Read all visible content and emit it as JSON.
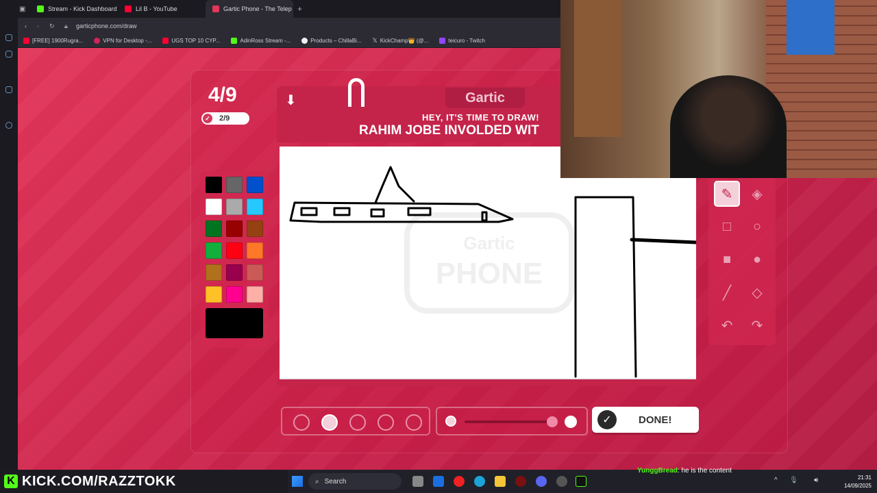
{
  "browser": {
    "tabs": [
      {
        "label": "Stream - Kick Dashboard",
        "color": "#53fc18"
      },
      {
        "label": "Lil B - YouTube",
        "color": "#ff0033"
      },
      {
        "label": "Gartic Phone - The Telep",
        "color": "#e2365a",
        "active": true
      }
    ],
    "url": "garticphone.com/draw",
    "bookmarks": [
      {
        "label": "[FREE] 1900Rugra...",
        "color": "#ff0033"
      },
      {
        "label": "VPN for Desktop -...",
        "color": "#d0245a"
      },
      {
        "label": "UGS TOP 10 CYP...",
        "color": "#ff0033"
      },
      {
        "label": "AdinRoss Stream -...",
        "color": "#53fc18"
      },
      {
        "label": "Products – ChillaBi...",
        "color": "#f0f0f0"
      },
      {
        "label": "KickChamp👑 (@...",
        "color": "#ffffff"
      },
      {
        "label": "teicuro - Twitch",
        "color": "#9146ff"
      }
    ]
  },
  "game": {
    "round": "4/9",
    "done_count": "2/9",
    "logo": "Gartic",
    "prompt_heading": "HEY, IT'S TIME TO DRAW!",
    "prompt_text": "RAHIM JOBE INVOLDED WIT",
    "watermark_top": "Gartic",
    "watermark_bottom": "PHONE",
    "done_label": "DONE!",
    "palette": [
      "#000000",
      "#666666",
      "#0050cd",
      "#ffffff",
      "#aaaaaa",
      "#26c9ff",
      "#017420",
      "#990000",
      "#964112",
      "#11b03c",
      "#ff0013",
      "#ff7829",
      "#b0701c",
      "#99004e",
      "#cb5a57",
      "#ffc126",
      "#ff008f",
      "#feafa8"
    ],
    "current_color": "#000000"
  },
  "brand": {
    "k": "K",
    "text": "KICK.COM/RAZZTOKK"
  },
  "taskbar": {
    "search": "Search",
    "time": "21:31",
    "date": "14/09/2025"
  },
  "chat": {
    "user": "YunggBread",
    "message": ": he is the content"
  }
}
